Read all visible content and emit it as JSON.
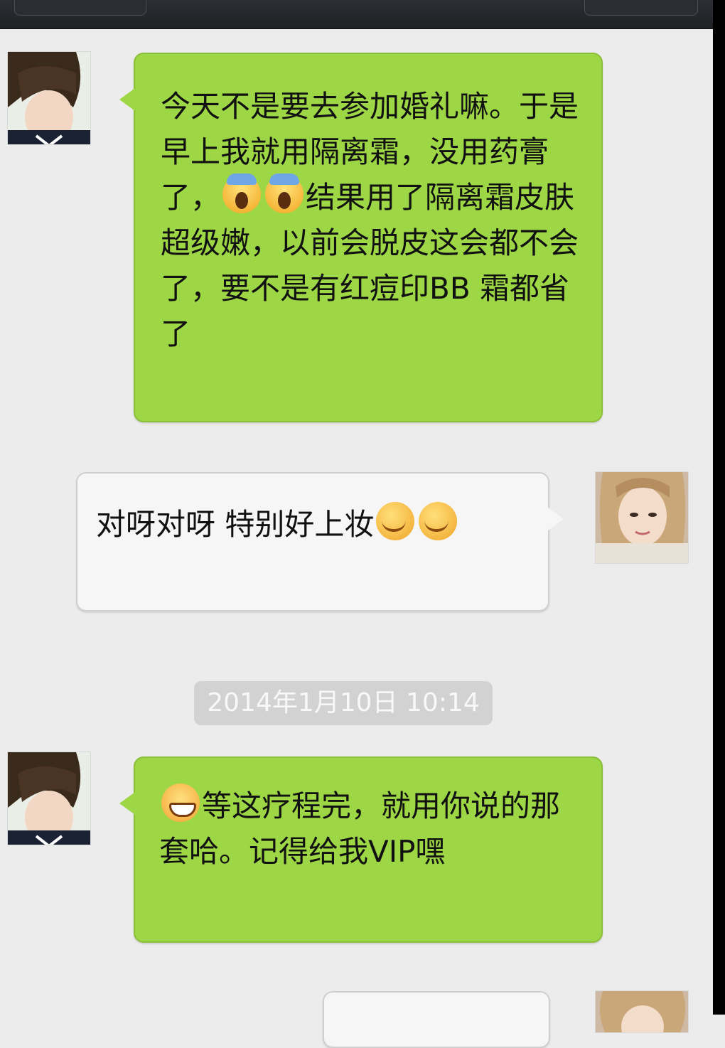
{
  "header": {
    "back_label": "",
    "title": "",
    "more_label": ""
  },
  "messages": [
    {
      "sender": "contact",
      "avatar": "avatar-contact",
      "segments": [
        {
          "type": "text",
          "value": "今天不是要去参加婚礼嘛。于是早上我就用隔离霜，没用药膏了，"
        },
        {
          "type": "emoji",
          "name": "face-screaming-emoji"
        },
        {
          "type": "emoji",
          "name": "face-screaming-emoji"
        },
        {
          "type": "text",
          "value": "结果用了隔离霜皮肤超级嫩，以前会脱皮这会都不会了，要不是有红痘印BB 霜都省了"
        }
      ]
    },
    {
      "sender": "self",
      "avatar": "avatar-self",
      "segments": [
        {
          "type": "text",
          "value": "对呀对呀 特别好上妆"
        },
        {
          "type": "emoji",
          "name": "giggle-covering-mouth-emoji"
        },
        {
          "type": "emoji",
          "name": "giggle-covering-mouth-emoji"
        }
      ]
    },
    {
      "sender": "contact",
      "avatar": "avatar-contact",
      "segments": [
        {
          "type": "emoji",
          "name": "grinning-face-emoji"
        },
        {
          "type": "text",
          "value": "等这疗程完，就用你说的那套哈。记得给我VIP嘿"
        }
      ]
    }
  ],
  "timestamp": "2014年1月10日 10:14",
  "colors": {
    "outgoing_bubble": "#9ed745",
    "incoming_bubble": "#f6f6f6",
    "chat_background": "#ececec",
    "nav_bar": "#2b2f33"
  }
}
